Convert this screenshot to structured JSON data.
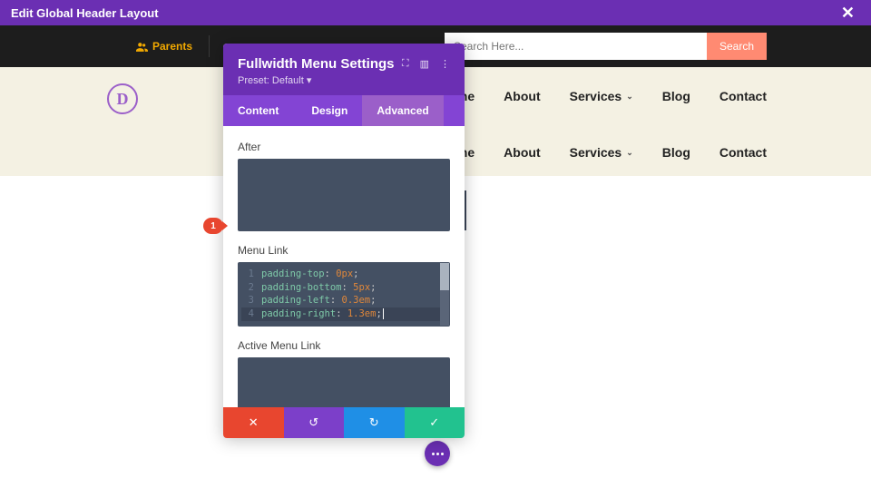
{
  "topbar": {
    "title": "Edit Global Header Layout"
  },
  "darkbar": {
    "parents": "Parents"
  },
  "search": {
    "placeholder": "Search Here...",
    "visible_fragment": "h Here...",
    "button": "Search"
  },
  "menu": {
    "items": [
      "Home",
      "About",
      "Services",
      "Blog",
      "Contact"
    ]
  },
  "panel": {
    "title": "Fullwidth Menu Settings",
    "preset": "Preset: Default",
    "tabs": [
      "Content",
      "Design",
      "Advanced"
    ],
    "active_tab": 2,
    "fields": {
      "after": "After",
      "menu_link": "Menu Link",
      "active_menu_link": "Active Menu Link"
    },
    "code": [
      {
        "n": "1",
        "prop": "padding-top",
        "val": "0px"
      },
      {
        "n": "2",
        "prop": "padding-bottom",
        "val": "5px"
      },
      {
        "n": "3",
        "prop": "padding-left",
        "val": "0.3em"
      },
      {
        "n": "4",
        "prop": "padding-right",
        "val": "1.3em"
      }
    ]
  },
  "marker": {
    "label": "1"
  }
}
